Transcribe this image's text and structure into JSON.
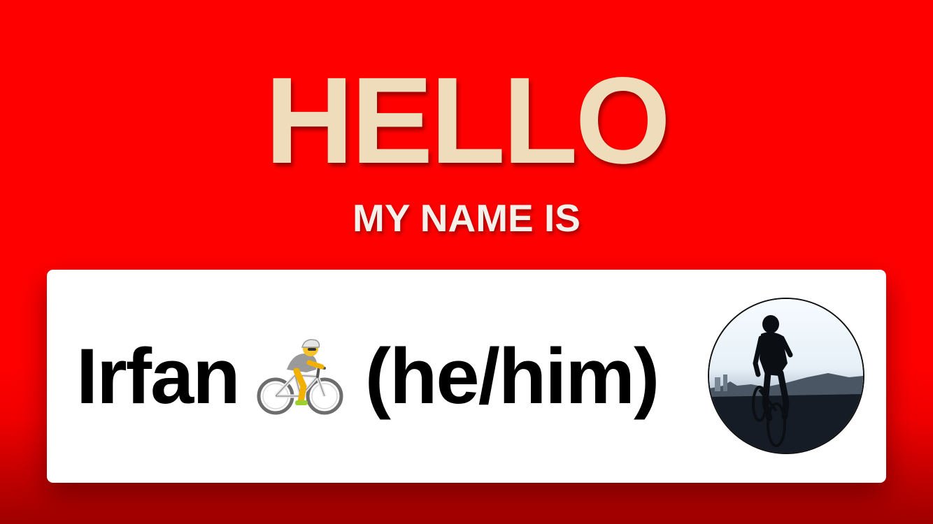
{
  "badge": {
    "hello": "HELLO",
    "subtitle": "MY NAME IS",
    "name": "Irfan",
    "pronouns": "(he/him)",
    "emoji_icon": "cyclist-emoji-icon",
    "avatar_icon": "cyclist-photo-avatar"
  },
  "colors": {
    "background": "#ff0000",
    "hello_text": "#efdcbb",
    "subtitle_text": "#f4f0ea",
    "card": "#ffffff",
    "name_text": "#000000"
  }
}
